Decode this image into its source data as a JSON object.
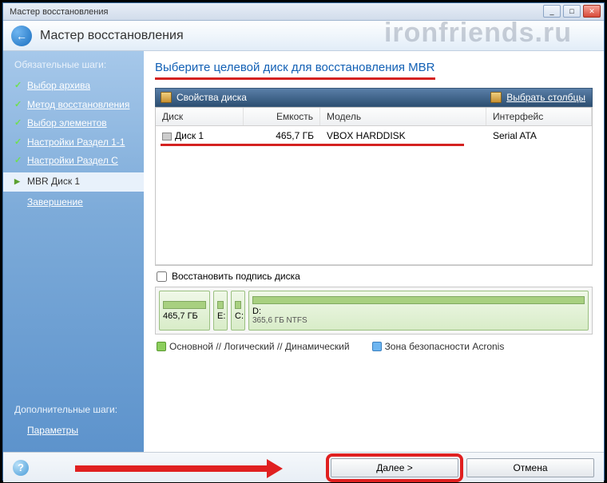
{
  "window": {
    "title": "Мастер восстановления"
  },
  "header": {
    "title": "Мастер восстановления"
  },
  "watermark": "ironfriends.ru",
  "sidebar": {
    "section1": "Обязательные шаги:",
    "steps": [
      "Выбор архива",
      "Метод восстановления",
      "Выбор элементов",
      "Настройки Раздел 1-1",
      "Настройки Раздел C",
      "MBR Диск 1",
      "Завершение"
    ],
    "section2": "Дополнительные шаги:",
    "params": "Параметры"
  },
  "main": {
    "title": "Выберите целевой диск для восстановления MBR",
    "toolbar": {
      "props": "Свойства диска",
      "cols": "Выбрать столбцы"
    },
    "table": {
      "headers": {
        "disk": "Диск",
        "capacity": "Емкость",
        "model": "Модель",
        "iface": "Интерфейс"
      },
      "row": {
        "disk": "Диск 1",
        "capacity": "465,7 ГБ",
        "model": "VBOX HARDDISK",
        "iface": "Serial ATA"
      }
    },
    "restore_sig": "Восстановить подпись диска",
    "partitions": {
      "total": "465,7 ГБ",
      "e": "E:",
      "c": "C:",
      "d": "D:",
      "d_detail": "365,6 ГБ  NTFS"
    },
    "legend": {
      "primary": "Основной // Логический // Динамический",
      "acronis": "Зона безопасности Acronis"
    }
  },
  "footer": {
    "next": "Далее >",
    "cancel": "Отмена"
  }
}
